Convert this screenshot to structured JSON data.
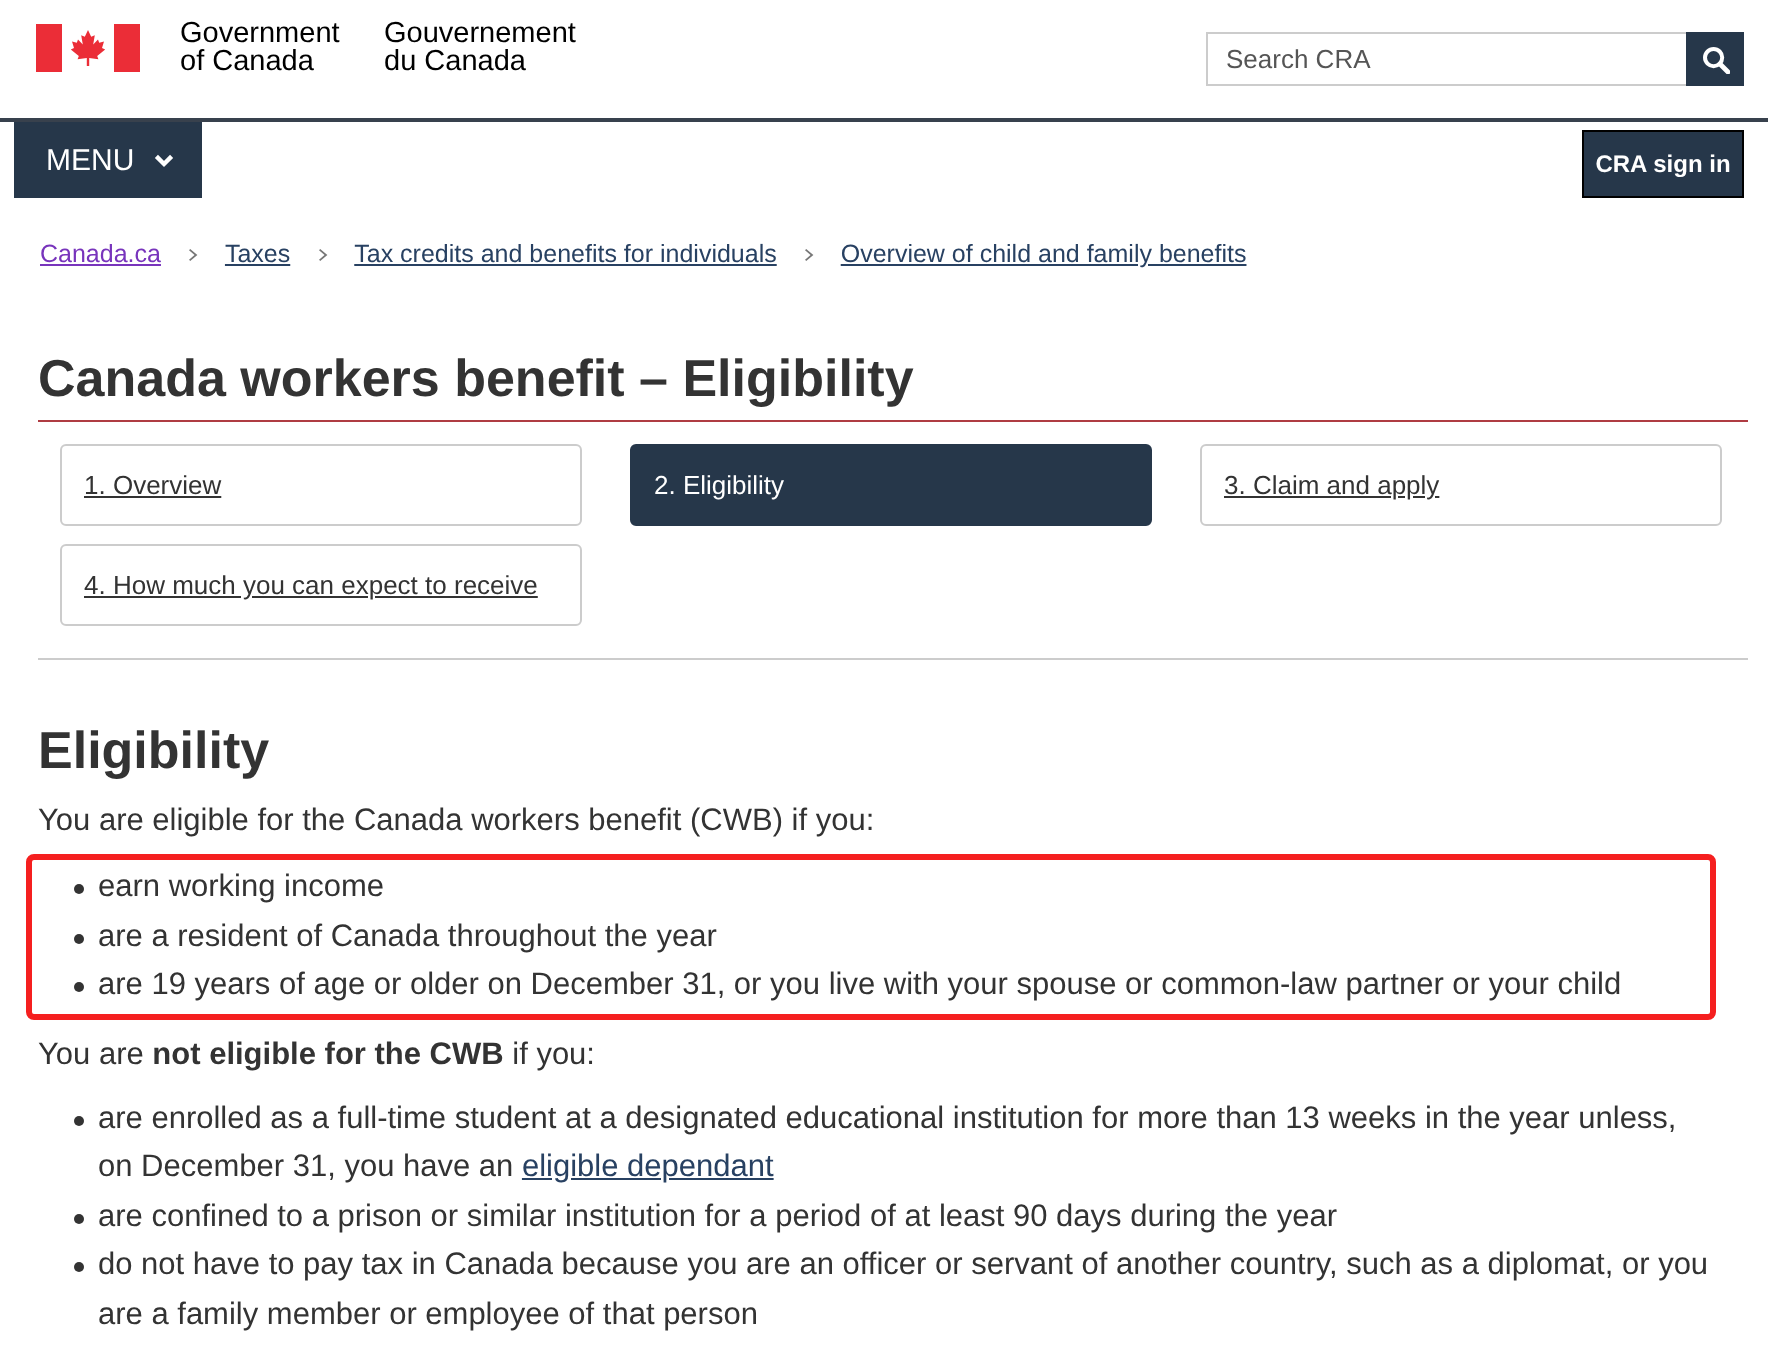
{
  "header": {
    "signature_en": "Government of Canada",
    "signature_fr": "Gouvernement du Canada",
    "search": {
      "placeholder": "Search CRA"
    }
  },
  "nav": {
    "menu_button": "MENU",
    "sign_in_button": "CRA sign in"
  },
  "breadcrumbs": [
    {
      "label": "Canada.ca",
      "visited": true
    },
    {
      "label": "Taxes",
      "visited": false
    },
    {
      "label": "Tax credits and benefits for individuals",
      "visited": false
    },
    {
      "label": "Overview of child and family benefits",
      "visited": false
    }
  ],
  "title": "Canada workers benefit – Eligibility",
  "steps": [
    {
      "label": "1. Overview",
      "selected": false
    },
    {
      "label": "2. Eligibility",
      "selected": true
    },
    {
      "label": "3. Claim and apply",
      "selected": false
    },
    {
      "label": "4. How much you can expect to receive",
      "selected": false
    }
  ],
  "section": {
    "heading": "Eligibility",
    "intro": "You are eligible for the Canada workers benefit (CWB) if you:",
    "eligible_list": {
      "highlighted": true,
      "items": [
        "earn working income",
        "are a resident of Canada throughout the year",
        "are 19 years of age or older on December 31, or you live with your spouse or common-law partner or your child"
      ]
    },
    "not_eligible_intro": "You are **not eligible for the CWB** if you:",
    "not_eligible_items": [
      {
        "text": "are enrolled as a full-time student at a designated educational institution for more than 13 weeks in the year unless, on December 31, you have an ",
        "link": "eligible dependant"
      },
      {
        "text": "are confined to a prison or similar institution for a period of at least 90 days during the year"
      },
      {
        "text": "do not have to pay tax in Canada because you are an officer or servant of another country, such as a diplomat, or you are a family member or employee of that person"
      }
    ]
  }
}
